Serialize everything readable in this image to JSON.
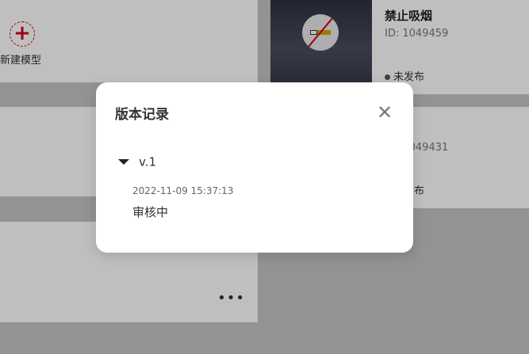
{
  "background": {
    "new_model_label": "新建模型",
    "new_icon": "plus-icon",
    "more_icon": "more-dots-icon",
    "models": [
      {
        "name": "禁止吸烟",
        "id": "ID: 1049459",
        "status": "未发布"
      },
      {
        "name": "",
        "id": "ID: 1049431",
        "status": "未发布"
      }
    ]
  },
  "modal": {
    "title": "版本记录",
    "close_icon": "close-icon",
    "versions": [
      {
        "label": "v.1",
        "records": [
          {
            "time": "2022-11-09 15:37:13",
            "status": "审核中"
          }
        ]
      }
    ]
  }
}
